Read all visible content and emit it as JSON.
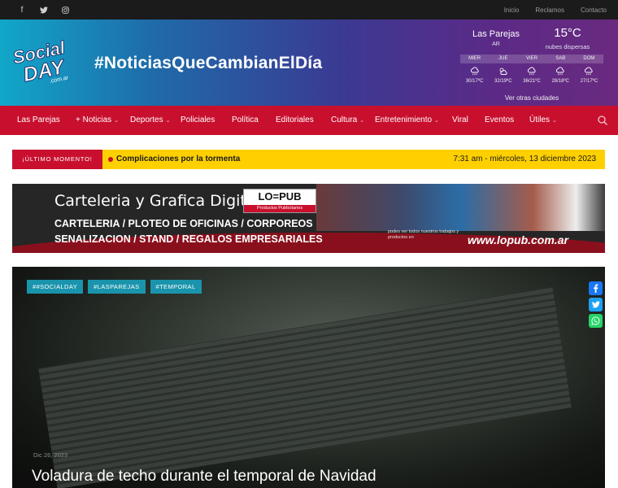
{
  "topbar": {
    "social": [
      {
        "icon": "facebook-icon",
        "glyph": "f"
      },
      {
        "icon": "twitter-icon",
        "glyph": "🐦"
      },
      {
        "icon": "instagram-icon",
        "glyph": "◎"
      }
    ],
    "links": [
      "Inicio",
      "Reclamos",
      "Contacto"
    ]
  },
  "header": {
    "logo": {
      "line1": "Social",
      "line2": "DAY",
      "suffix": ".com.ar"
    },
    "tagline": "#NoticiasQueCambianElDía"
  },
  "weather": {
    "city": "Las Parejas",
    "country": "AR",
    "temp_value": "15",
    "temp_unit": "°C",
    "description": "nubes dispersas",
    "days": [
      "MIER",
      "JUE",
      "VIER",
      "SAB",
      "DOM"
    ],
    "ranges": [
      "30/17ºC",
      "32/19ºC",
      "36/21ºC",
      "28/18ºC",
      "27/17ºC"
    ],
    "more_link": "Ver otras ciudades"
  },
  "nav": {
    "items": [
      {
        "label": "Las Parejas",
        "dropdown": false
      },
      {
        "label": "+ Noticias",
        "dropdown": true
      },
      {
        "label": "Deportes",
        "dropdown": true
      },
      {
        "label": "Policiales",
        "dropdown": false
      },
      {
        "label": "Política",
        "dropdown": false
      },
      {
        "label": "Editoriales",
        "dropdown": false
      },
      {
        "label": "Cultura",
        "dropdown": true
      },
      {
        "label": "Entretenimiento",
        "dropdown": true
      },
      {
        "label": "Viral",
        "dropdown": false
      },
      {
        "label": "Eventos",
        "dropdown": false
      },
      {
        "label": "Útiles",
        "dropdown": true
      }
    ],
    "search_icon": "search-icon"
  },
  "breaking": {
    "label": "¡ÚLTIMO MOMENTO!",
    "headline": "Complicaciones por la tormenta",
    "datetime": "7:31 am - miércoles, 13 diciembre 2023"
  },
  "banner": {
    "title": "Carteleria y Grafica Digital",
    "logo_text": "LO=PUB",
    "logo_sub": "Productos Publicitarios",
    "line1": "CARTELERIA / PLOTEO DE OFICINAS / CORPOREOS",
    "line2": "SENALIZACION / STAND / REGALOS EMPRESARIALES",
    "cta_small": "podes ver todos nuestros trabajos y productos en",
    "url": "www.lopub.com.ar"
  },
  "hero": {
    "tags": [
      "##SOCIALDAY",
      "#LASPAREJAS",
      "#TEMPORAL"
    ],
    "share": [
      {
        "icon": "facebook-icon",
        "color": "#1877f2"
      },
      {
        "icon": "twitter-icon",
        "color": "#1da1f2"
      },
      {
        "icon": "whatsapp-icon",
        "color": "#25d366"
      }
    ],
    "date": "Dic 26, 2023",
    "title": "Voladura de techo durante el temporal de Navidad"
  },
  "colors": {
    "nav_red": "#c8102e",
    "breaking_yellow": "#ffd000",
    "tag_teal": "#1a94ad",
    "topbar": "#1b1b1b"
  }
}
